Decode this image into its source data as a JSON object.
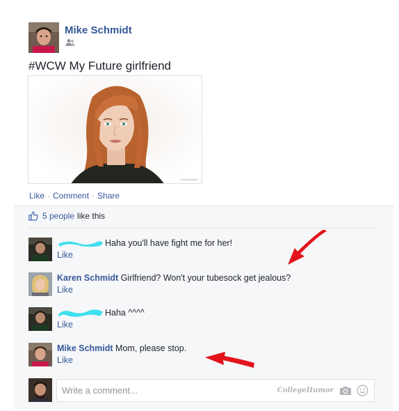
{
  "post": {
    "author": "Mike Schmidt",
    "text": "#WCW My Future girlfriend",
    "photo_watermark": "CollegeHumor",
    "audience_icon": "friends-icon",
    "actions": {
      "like": "Like",
      "comment": "Comment",
      "share": "Share",
      "separator": "·"
    }
  },
  "feedback": {
    "likes_count": "5 people",
    "likes_suffix": "like this",
    "comments": [
      {
        "name": "",
        "text": "Haha you'll have fight me for her!",
        "like": "Like",
        "name_redacted": true
      },
      {
        "name": "Karen Schmidt",
        "text": "Girlfriend? Won't your tubesock get jealous?",
        "like": "Like",
        "name_redacted": false
      },
      {
        "name": "",
        "text": "Haha ^^^^",
        "like": "Like",
        "name_redacted": true
      },
      {
        "name": "Mike Schmidt",
        "text": "Mom, please stop.",
        "like": "Like",
        "name_redacted": false
      }
    ],
    "composer": {
      "placeholder": "Write a comment...",
      "watermark": "CollegeHumor",
      "icons": [
        "camera-icon",
        "smiley-icon"
      ]
    }
  },
  "colors": {
    "link": "#365899",
    "text": "#1d2129",
    "muted": "#90949c",
    "feedback_bg": "#f6f7f9",
    "annotation_arrow": "#e3141c",
    "redaction": "#3ee0ee"
  }
}
